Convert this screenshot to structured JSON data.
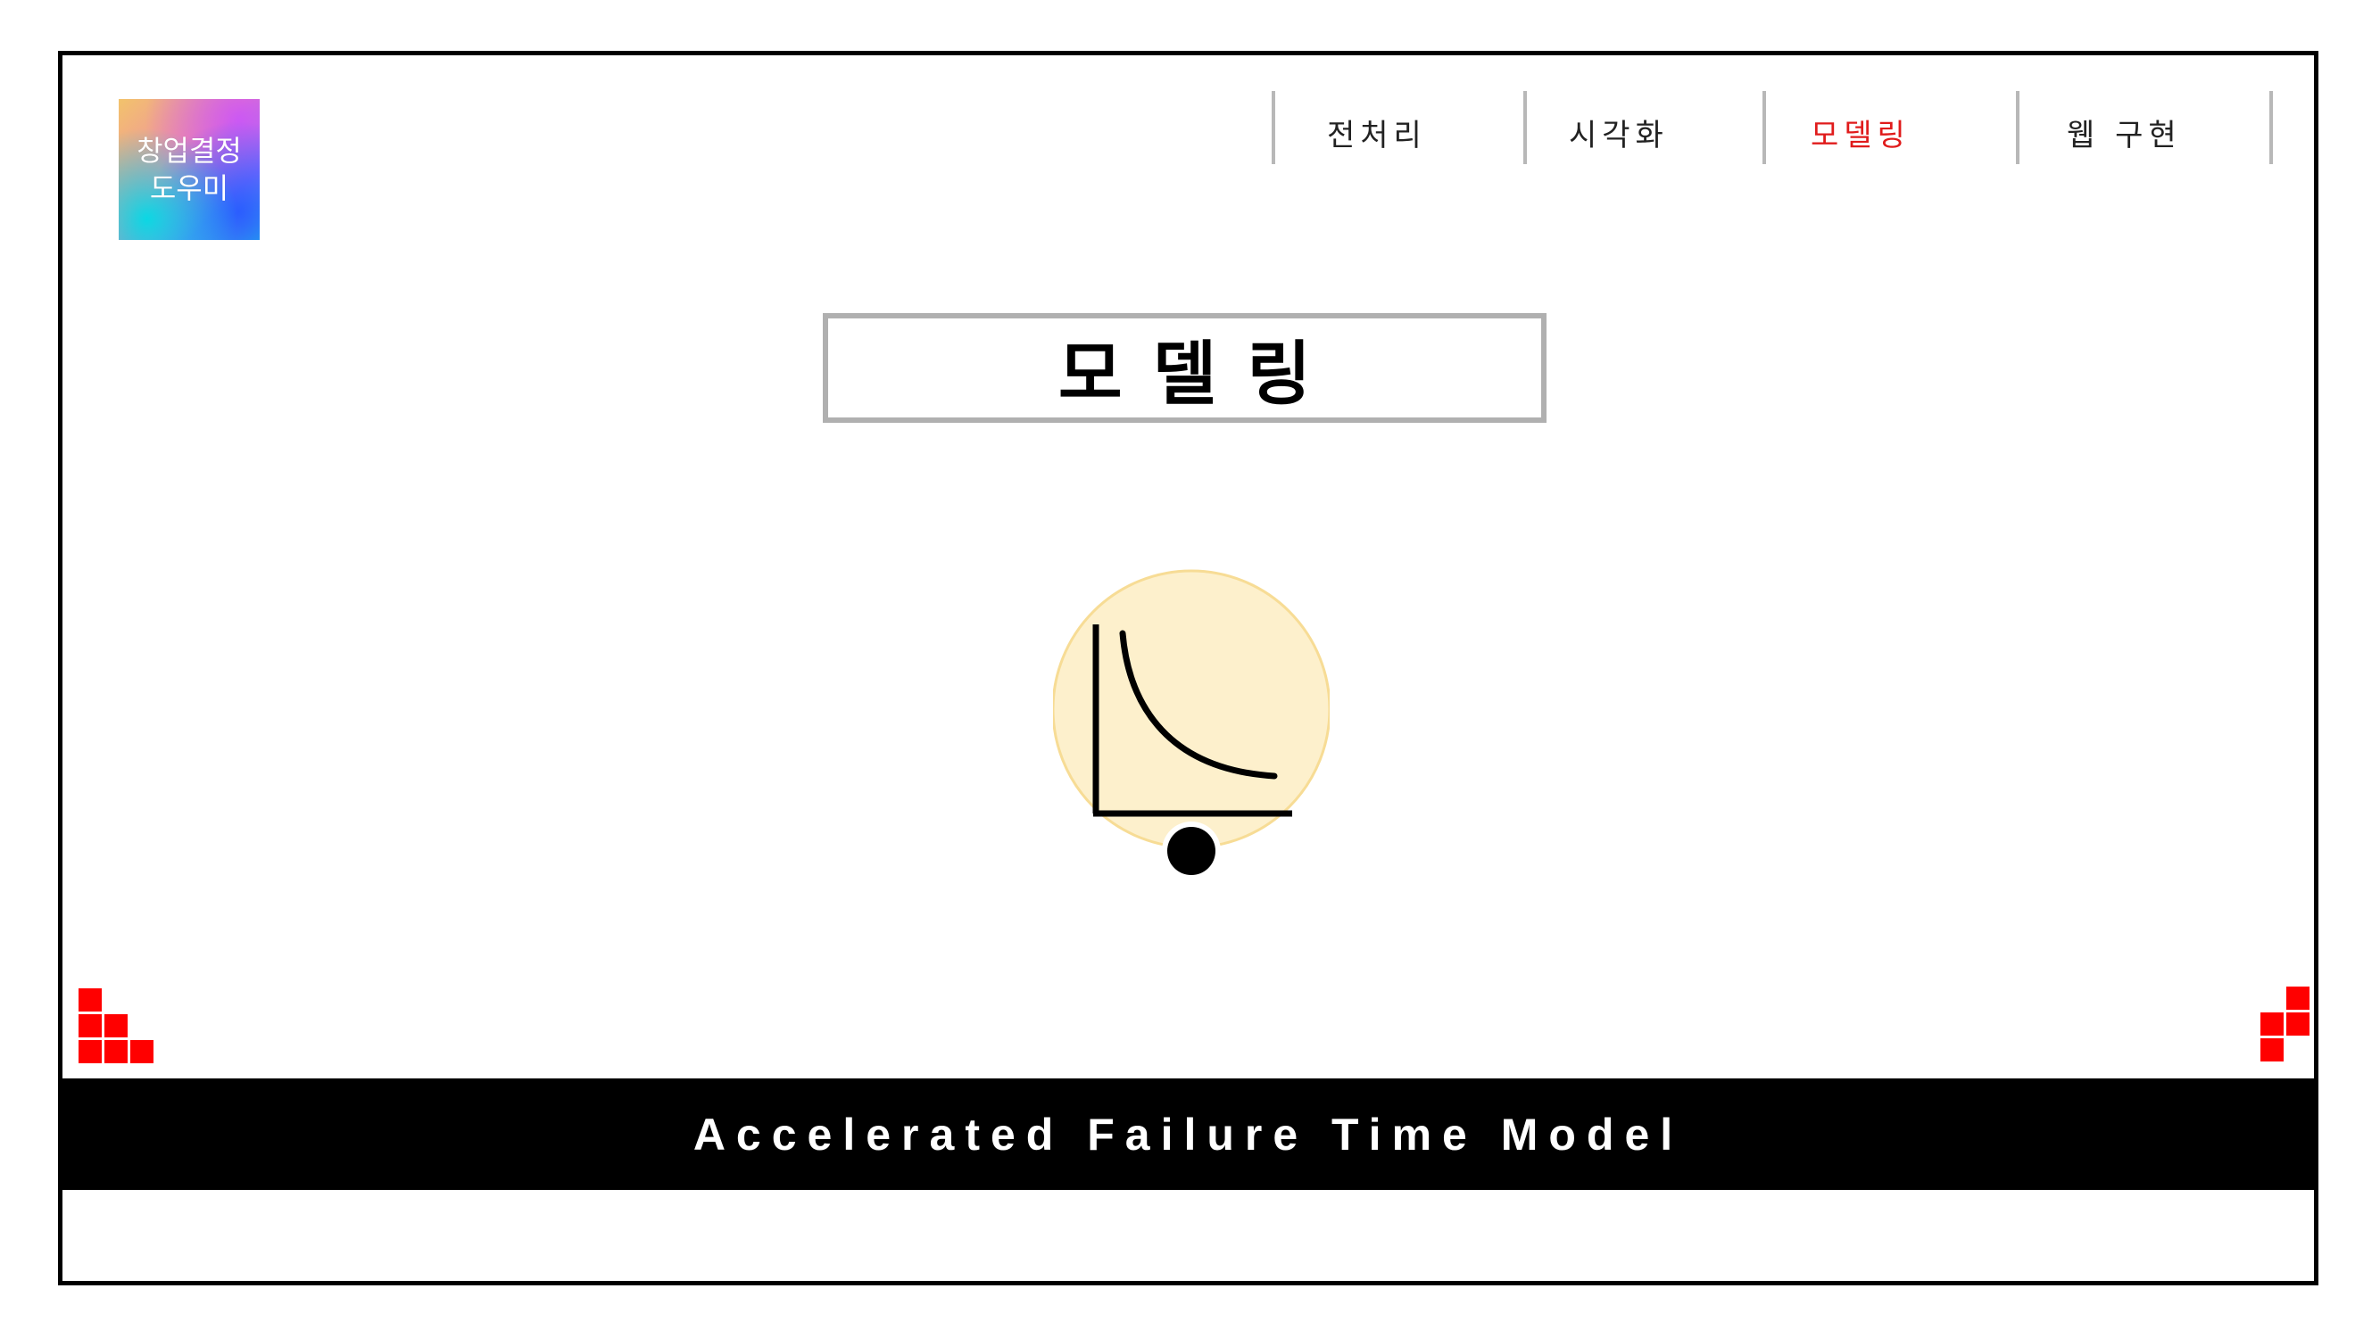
{
  "logo": {
    "line1": "창업결정",
    "line2": "도우미"
  },
  "nav": {
    "items": [
      {
        "label": "전처리",
        "active": false
      },
      {
        "label": "시각화",
        "active": false
      },
      {
        "label": "모델링",
        "active": true
      },
      {
        "label": "웹 구현",
        "active": false
      }
    ],
    "active_color": "#e01b1b"
  },
  "page": {
    "title": "모델링"
  },
  "illustration": {
    "icon": "decay-curve-chart-icon",
    "circle_color": "#fdf0cc"
  },
  "footer": {
    "text": "Accelerated Failure Time Model"
  },
  "decor": {
    "pixel_color": "#ff0000"
  }
}
